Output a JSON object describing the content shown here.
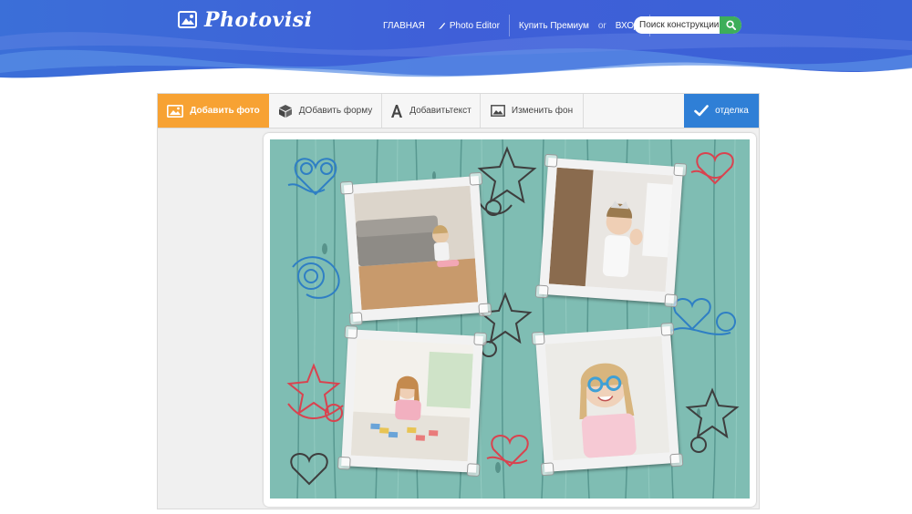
{
  "header": {
    "logo_text": "Photovisi",
    "nav": {
      "home": "ГЛАВНАЯ",
      "photo_editor": "Photo Editor",
      "premium": "Купить Премиум",
      "or": "or",
      "login": "ВХОД"
    },
    "search": {
      "placeholder": "Поиск конструкции"
    }
  },
  "toolbar": {
    "add_photo": "Добавить фото",
    "add_shape": "ДОбавить форму",
    "add_text": "Добавитьтекст",
    "change_bg": "Изменить фон",
    "done": "отделка"
  },
  "colors": {
    "header_blue": "#3a63d6",
    "accent_orange": "#f7a233",
    "done_blue": "#2f7fd6",
    "search_green": "#3dae5a",
    "wood_teal": "#7fbdb3"
  },
  "icons": {
    "logo": "photos-icon",
    "brush": "brush-icon",
    "search": "search-icon",
    "add_photo": "image-icon",
    "add_shape": "cube-icon",
    "add_text": "letter-a-icon",
    "change_bg": "picture-icon",
    "done": "check-icon"
  }
}
